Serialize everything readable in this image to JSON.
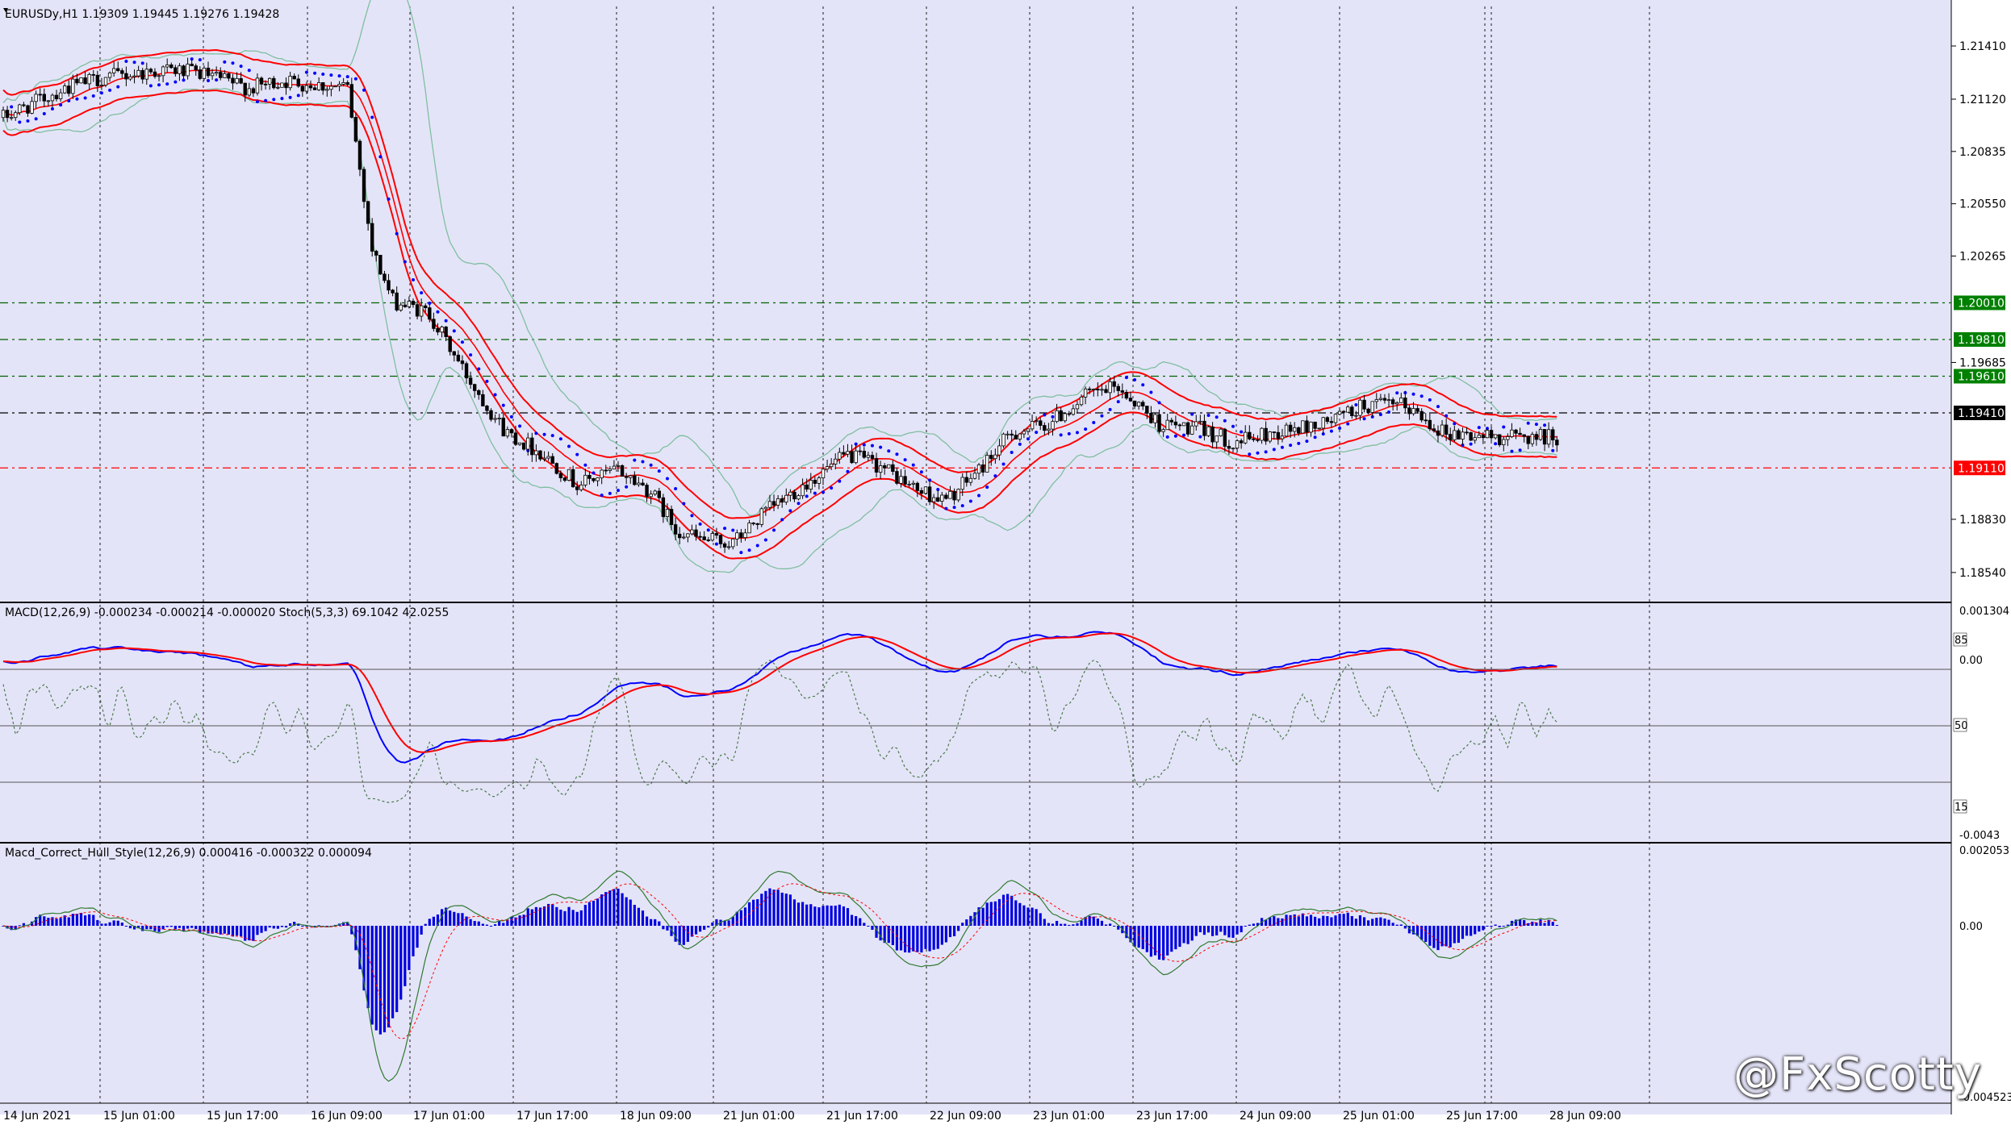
{
  "colors": {
    "background": "#e4e4f8",
    "grid": "#1a1a1a",
    "candle_up": "#ffffff",
    "candle_down": "#000000",
    "envelope_red": "#ff0000",
    "bollinger_green": "#7fbf9f",
    "sar_blue": "#0000ff",
    "macd_blue": "#0000ff",
    "macd_signal_red": "#ff0000",
    "stoch_green": "#4a7a4a",
    "hist_blue": "#0000e0",
    "level_green_bg": "#008000",
    "level_red_bg": "#ff0000",
    "level_black_bg": "#000000",
    "level_label_fg": "#ffffff"
  },
  "header": {
    "symbol_line": "EURUSDy,H1  1.19309 1.19445 1.19276 1.19428"
  },
  "watermark": "@FxScotty",
  "chart_data": [
    {
      "type": "candlestick",
      "name": "EURUSDy,H1",
      "ohlc_header": [
        "1.19309",
        "1.19445",
        "1.19276",
        "1.19428"
      ],
      "y_ticks": [
        "1.21410",
        "1.21120",
        "1.20835",
        "1.20550",
        "1.20265",
        "1.19685",
        "1.18830",
        "1.18540"
      ],
      "ylim": [
        1.1825,
        1.2165
      ],
      "grid": true,
      "x_ticks": [
        "14 Jun 2021",
        "15 Jun 01:00",
        "15 Jun 17:00",
        "16 Jun 09:00",
        "17 Jun 01:00",
        "17 Jun 17:00",
        "18 Jun 09:00",
        "21 Jun 01:00",
        "21 Jun 17:00",
        "22 Jun 09:00",
        "23 Jun 01:00",
        "23 Jun 17:00",
        "24 Jun 09:00",
        "25 Jun 01:00",
        "25 Jun 17:00",
        "28 Jun 09:00"
      ],
      "levels": [
        {
          "value": 1.2001,
          "label": "1.20010",
          "style": "green"
        },
        {
          "value": 1.1981,
          "label": "1.19810",
          "style": "green"
        },
        {
          "value": 1.1961,
          "label": "1.19610",
          "style": "green"
        },
        {
          "value": 1.1941,
          "label": "1.19410",
          "style": "black"
        },
        {
          "value": 1.1911,
          "label": "1.19110",
          "style": "red"
        }
      ],
      "close_path": [
        [
          0,
          1.2102
        ],
        [
          15,
          1.2118
        ],
        [
          25,
          1.2124
        ],
        [
          40,
          1.2128
        ],
        [
          48,
          1.2126
        ],
        [
          60,
          1.2118
        ],
        [
          68,
          1.2122
        ],
        [
          84,
          1.2118
        ],
        [
          90,
          1.203
        ],
        [
          95,
          1.2002
        ],
        [
          104,
          1.1995
        ],
        [
          112,
          1.1965
        ],
        [
          122,
          1.1932
        ],
        [
          132,
          1.1918
        ],
        [
          140,
          1.1902
        ],
        [
          150,
          1.191
        ],
        [
          158,
          1.1898
        ],
        [
          164,
          1.1878
        ],
        [
          170,
          1.1872
        ],
        [
          178,
          1.187
        ],
        [
          186,
          1.1887
        ],
        [
          196,
          1.1903
        ],
        [
          206,
          1.1918
        ],
        [
          214,
          1.1912
        ],
        [
          222,
          1.19
        ],
        [
          230,
          1.1893
        ],
        [
          238,
          1.191
        ],
        [
          246,
          1.193
        ],
        [
          255,
          1.1935
        ],
        [
          264,
          1.195
        ],
        [
          272,
          1.1955
        ],
        [
          282,
          1.1935
        ],
        [
          292,
          1.1932
        ],
        [
          300,
          1.1925
        ],
        [
          310,
          1.193
        ],
        [
          322,
          1.1935
        ],
        [
          332,
          1.1945
        ],
        [
          342,
          1.1945
        ],
        [
          352,
          1.193
        ],
        [
          362,
          1.1928
        ]
      ]
    },
    {
      "type": "line",
      "name": "MACD(12,26,9) -0.000234 -0.000214 -0.000020 Stoch(5,3,3) 69.1042 42.0255",
      "y_ticks": [
        "0.001304",
        "85",
        "0.00",
        "50",
        "15",
        "-0.0043"
      ],
      "stoch_levels": [
        85,
        50,
        15
      ],
      "series": [
        {
          "name": "MACD",
          "color": "#0000ff"
        },
        {
          "name": "Signal",
          "color": "#ff0000"
        },
        {
          "name": "Stoch",
          "color": "#4a7a4a"
        }
      ]
    },
    {
      "type": "bar",
      "name": "Macd_Correct_Hull_Style(12,26,9) 0.000416 -0.000322 0.000094",
      "y_ticks": [
        "0.002053",
        "0.00",
        "-0.004523"
      ],
      "ylim": [
        -0.004523,
        0.002053
      ]
    }
  ]
}
